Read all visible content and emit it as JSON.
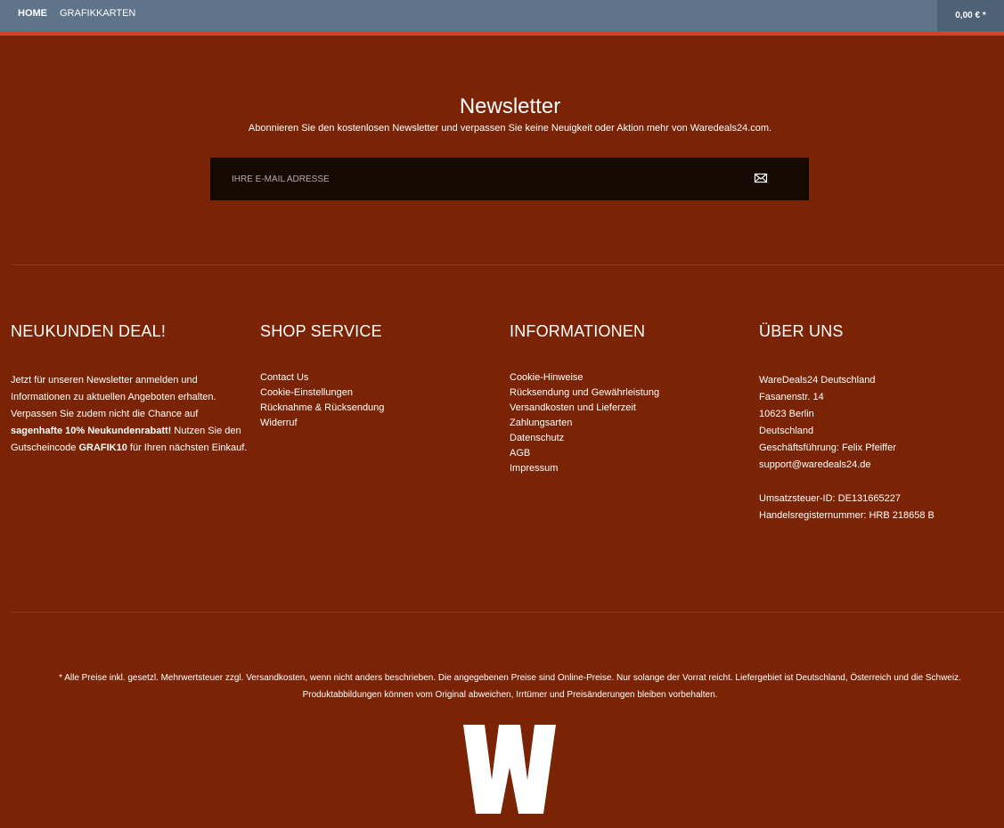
{
  "nav": {
    "items": [
      {
        "label": "HOME"
      },
      {
        "label": "GRAFIKKARTEN"
      }
    ],
    "cart_total": "0,00 € *"
  },
  "newsletter": {
    "title": "Newsletter",
    "subtitle": "Abonnieren Sie den kostenlosen Newsletter und verpassen Sie keine Neuigkeit oder Aktion mehr von Waredeals24.com.",
    "email_placeholder": "Ihre E-Mail Adresse",
    "email_value": ""
  },
  "footer": {
    "deal": {
      "title": "NEUKUNDEN DEAL!",
      "text_1": "Jetzt für unseren Newsletter anmelden und Informationen zu aktuellen Angeboten erhalten. Verpassen Sie zudem nicht die Chance auf ",
      "highlight": "sagenhafte 10% Neukundenrabatt!",
      "text_2": " Nutzen Sie den Gutscheincode ",
      "code": "GRAFIK10",
      "text_3": " für Ihren nächsten Einkauf."
    },
    "service": {
      "title": "SHOP SERVICE",
      "links": [
        "Contact Us",
        "Cookie-Einstellungen",
        "Rücknahme & Rücksendung",
        "Widerruf"
      ]
    },
    "info": {
      "title": "INFORMATIONEN",
      "links": [
        "Cookie-Hinweise",
        "Rücksendung und Gewährleistung",
        "Versandkosten und Lieferzeit",
        "Zahlungsarten",
        "Datenschutz",
        "AGB",
        "Impressum"
      ]
    },
    "about": {
      "title": "ÜBER UNS",
      "lines": [
        "WareDeals24 Deutschland",
        "Fasanenstr. 14",
        "10623 Berlin",
        "Deutschland",
        "Geschäftsführung: Felix Pfeiffer",
        "support@waredeals24.de",
        "",
        "Umsatzsteuer-ID: DE131665227",
        "Handelsregisternummer: HRB 218658 B"
      ]
    },
    "disclaimer_1": "* Alle Preise inkl. gesetzl. Mehrwertsteuer zzgl. Versandkosten, wenn nicht anders beschrieben. Die angegebenen Preise sind Online-Preise. Nur solange der Vorrat reicht. Liefergebiet ist Deutschland, Österreich und die Schweiz.",
    "disclaimer_2": "Produktabbildungen können vom Original abweichen, Irrtümer und Preisänderungen bleiben vorbehalten.",
    "logo_letter": "W"
  },
  "colors": {
    "background": "#7a2305",
    "nav": "#5f7389",
    "accent": "#d2461a",
    "input_bg": "#150902"
  },
  "icons": {
    "send": "envelope-icon"
  }
}
